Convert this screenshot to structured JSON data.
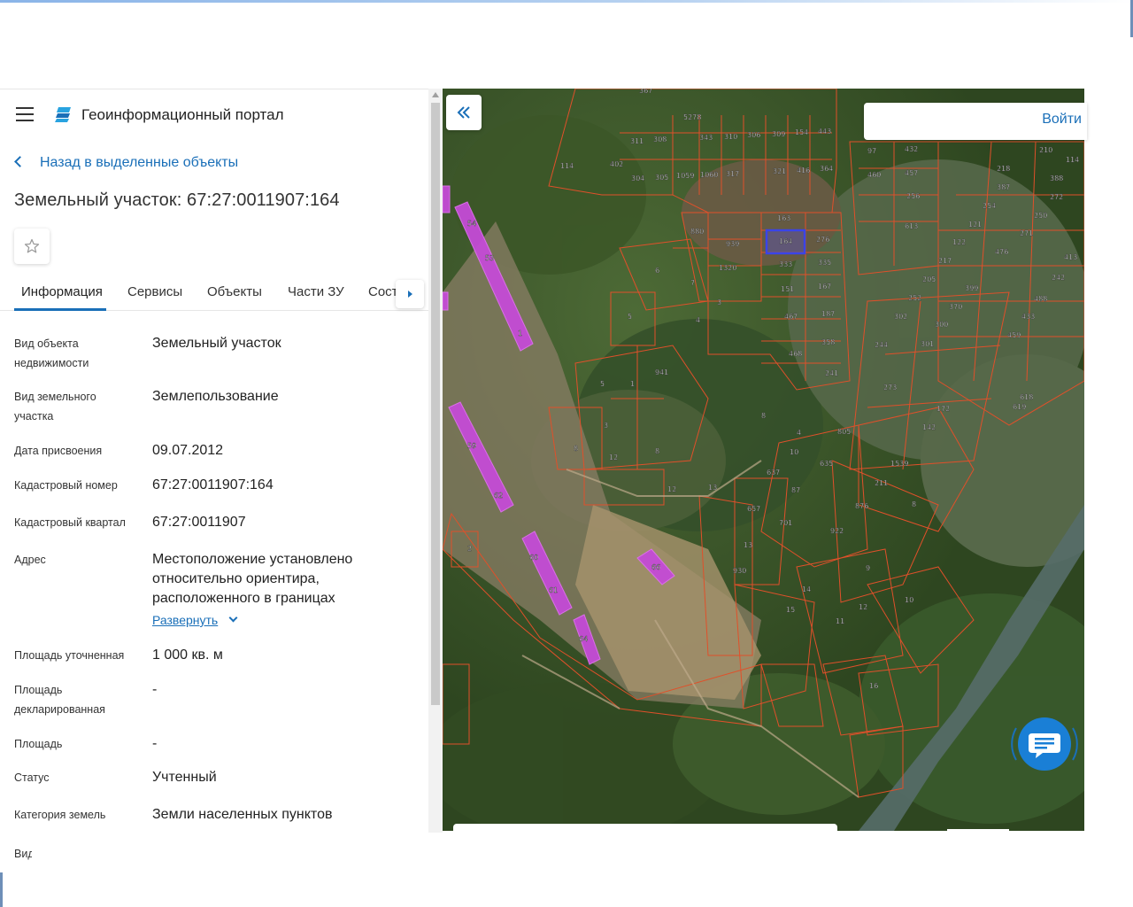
{
  "app": {
    "title": "Геоинформационный портал"
  },
  "nav": {
    "back_label": "Назад в выделенные объекты"
  },
  "object": {
    "title": "Земельный участок: 67:27:0011907:164"
  },
  "tabs": [
    {
      "label": "Информация",
      "active": true
    },
    {
      "label": "Сервисы",
      "active": false
    },
    {
      "label": "Объекты",
      "active": false
    },
    {
      "label": "Части ЗУ",
      "active": false
    },
    {
      "label": "Сост",
      "active": false
    }
  ],
  "properties": [
    {
      "label": "Вид объекта недвижимости",
      "value": "Земельный участок"
    },
    {
      "label": "Вид земельного участка",
      "value": "Землепользование"
    },
    {
      "label": "Дата присвоения",
      "value": "09.07.2012"
    },
    {
      "label": "Кадастровый номер",
      "value": "67:27:0011907:164"
    },
    {
      "label": "Кадастровый квартал",
      "value": "67:27:0011907"
    },
    {
      "label": "Адрес",
      "value": "Местоположение установлено относительно ориентира, расположенного в границах",
      "expand_label": "Развернуть"
    },
    {
      "label": "Площадь уточненная",
      "value": "1 000 кв. м"
    },
    {
      "label": "Площадь декларированная",
      "value": "-"
    },
    {
      "label": "Площадь",
      "value": "-"
    },
    {
      "label": "Статус",
      "value": "Учтенный"
    },
    {
      "label": "Категория земель",
      "value": "Земли населенных пунктов"
    },
    {
      "label": "Вид",
      "value": ""
    }
  ],
  "map": {
    "login_label": "Войти",
    "selected_parcel": "164",
    "parcel_labels": [
      "367",
      "5278",
      "311",
      "308",
      "343",
      "310",
      "306",
      "309",
      "154",
      "443",
      "114",
      "402",
      "304",
      "305",
      "1059",
      "1060",
      "317",
      "321",
      "416",
      "364",
      "880",
      "939",
      "163",
      "164",
      "276",
      "1320",
      "333",
      "335",
      "151",
      "167",
      "467",
      "187",
      "358",
      "468",
      "241",
      "6",
      "7",
      "3",
      "5",
      "4",
      "97",
      "432",
      "460",
      "457",
      "256",
      "613",
      "218",
      "210",
      "387",
      "114",
      "388",
      "254",
      "272",
      "121",
      "250",
      "122",
      "271",
      "217",
      "476",
      "205",
      "413",
      "399",
      "242",
      "252",
      "370",
      "488",
      "302",
      "300",
      "433",
      "244",
      "301",
      "459",
      "273",
      "618",
      "619",
      "172",
      "142",
      "1539",
      "211",
      "876",
      "8",
      "922",
      "805",
      "635",
      "637",
      "87",
      "701",
      "657",
      "13",
      "930",
      "14",
      "15",
      "11",
      "12",
      "10",
      "16",
      "9",
      "2",
      "1",
      "54",
      "53",
      "59",
      "62",
      "60",
      "61",
      "64",
      "66",
      "941",
      "8",
      "12",
      "13",
      "2",
      "8",
      "12"
    ],
    "colors": {
      "parcel_border": "#e0502a",
      "cadastral_fill": "#c44bd6",
      "selected": "#3a44e8",
      "accent": "#1a6fb8"
    }
  },
  "icons": {
    "menu": "hamburger-icon",
    "logo": "portal-logo-icon",
    "back": "chevron-left-icon",
    "favorite": "star-icon",
    "tab_scroll": "caret-right-icon",
    "collapse": "double-chevron-left-icon",
    "expand": "chevron-down-icon",
    "chat": "chat-icon"
  }
}
